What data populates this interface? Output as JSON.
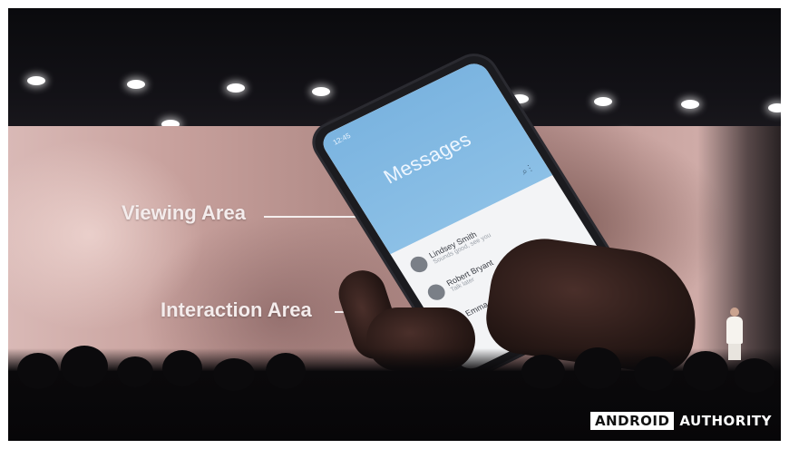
{
  "stage": {
    "labels": {
      "viewing": "Viewing Area",
      "interaction": "Interaction Area"
    }
  },
  "phone": {
    "status_time": "12:45",
    "app_title": "Messages",
    "contacts": [
      {
        "name": "Lindsey Smith",
        "preview": "Sounds good, see you"
      },
      {
        "name": "Robert Bryant",
        "preview": "Talk later"
      },
      {
        "name": "Emma Gray",
        "preview": ""
      }
    ]
  },
  "watermark": {
    "boxed": "ANDROID",
    "text": "AUTHORITY"
  }
}
